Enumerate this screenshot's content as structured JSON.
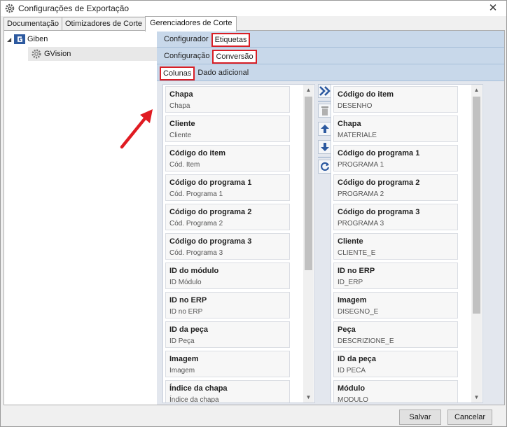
{
  "window": {
    "title": "Configurações de Exportação",
    "close_glyph": "✕"
  },
  "top_tabs": [
    {
      "label": "Documentação"
    },
    {
      "label": "Otimizadores de Corte"
    },
    {
      "label": "Gerenciadores de Corte"
    }
  ],
  "tree": {
    "root": {
      "label": "Giben",
      "icon": "giben-logo-icon"
    },
    "child": {
      "label": "GVision",
      "icon": "gear-icon"
    }
  },
  "tabs_level1": [
    {
      "label": "Configurador"
    },
    {
      "label": "Etiquetas"
    }
  ],
  "tabs_level2": [
    {
      "label": "Configuração"
    },
    {
      "label": "Conversão"
    }
  ],
  "tabs_level3": [
    {
      "label": "Colunas"
    },
    {
      "label": "Dado adicional"
    }
  ],
  "available_columns": [
    {
      "name": "Chapa",
      "alias": "Chapa"
    },
    {
      "name": "Cliente",
      "alias": "Cliente"
    },
    {
      "name": "Código do item",
      "alias": "Cód. Item"
    },
    {
      "name": "Código do programa 1",
      "alias": "Cód. Programa 1"
    },
    {
      "name": "Código do programa 2",
      "alias": "Cód. Programa 2"
    },
    {
      "name": "Código do programa 3",
      "alias": "Cód. Programa 3"
    },
    {
      "name": "ID do módulo",
      "alias": "ID Módulo"
    },
    {
      "name": "ID no ERP",
      "alias": "ID no ERP"
    },
    {
      "name": "ID da peça",
      "alias": "ID Peça"
    },
    {
      "name": "Imagem",
      "alias": "Imagem"
    },
    {
      "name": "Índice da chapa",
      "alias": "Índice da chapa"
    }
  ],
  "selected_columns": [
    {
      "name": "Código do item",
      "alias": "DESENHO"
    },
    {
      "name": "Chapa",
      "alias": "MATERIALE"
    },
    {
      "name": "Código do programa 1",
      "alias": "PROGRAMA 1"
    },
    {
      "name": "Código do programa 2",
      "alias": "PROGRAMA 2"
    },
    {
      "name": "Código do programa 3",
      "alias": "PROGRAMA 3"
    },
    {
      "name": "Cliente",
      "alias": "CLIENTE_E"
    },
    {
      "name": "ID no ERP",
      "alias": "ID_ERP"
    },
    {
      "name": "Imagem",
      "alias": "DISEGNO_E"
    },
    {
      "name": "Peça",
      "alias": "DESCRIZIONE_E"
    },
    {
      "name": "ID da peça",
      "alias": "ID PECA"
    },
    {
      "name": "Módulo",
      "alias": "MODULO"
    }
  ],
  "toolbar": [
    {
      "icon": "double-chevron-right-icon"
    },
    {
      "icon": "trash-icon"
    },
    {
      "icon": "arrow-up-icon"
    },
    {
      "icon": "arrow-down-icon"
    },
    {
      "icon": "refresh-icon"
    }
  ],
  "footer": {
    "save_label": "Salvar",
    "cancel_label": "Cancelar"
  },
  "colors": {
    "accent_blue": "#3a6db5",
    "highlight_red": "#d81f26",
    "tab_strip": "#c8d8ea"
  }
}
